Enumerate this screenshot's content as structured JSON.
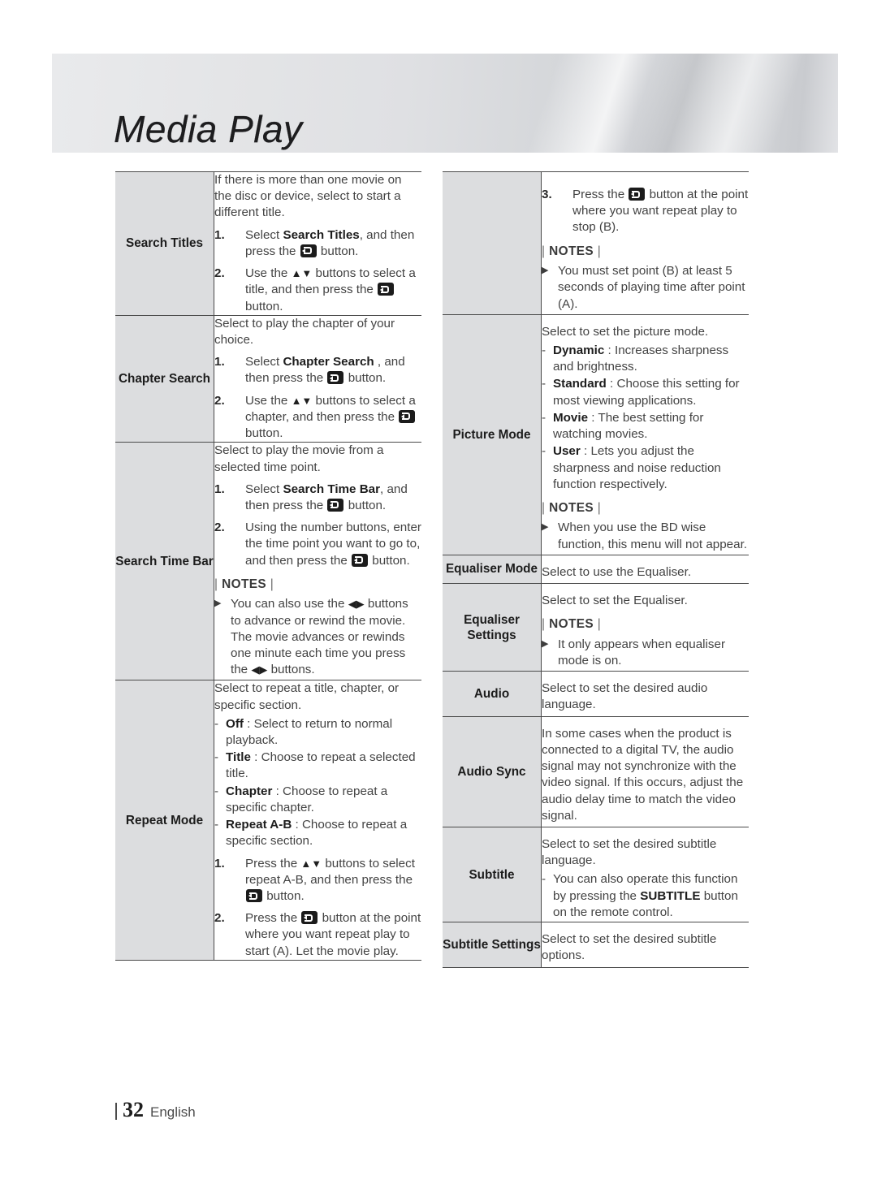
{
  "page": {
    "banner_title": "Media Play",
    "footer_page_number": "32",
    "footer_language": "English",
    "notes_label": "NOTES",
    "icon_enter_name": "enter-button-icon"
  },
  "left_column": [
    {
      "label": "Search Titles",
      "intro": "If there is more than one movie on the disc or device, select to start a different title.",
      "steps": [
        {
          "num": "1.",
          "pre": "Select ",
          "kw": "Search Titles",
          "post": ", and then press the ",
          "tail": " button."
        },
        {
          "num": "2.",
          "pre": "Use the ",
          "arrows": "▲▼",
          "post": " buttons to select a title, and then press the ",
          "tail": " button."
        }
      ]
    },
    {
      "label": "Chapter Search",
      "intro": "Select to play the chapter of your choice.",
      "steps": [
        {
          "num": "1.",
          "pre": "Select ",
          "kw": "Chapter Search",
          "post": " , and then press the ",
          "tail": " button."
        },
        {
          "num": "2.",
          "pre": "Use the ",
          "arrows": "▲▼",
          "post": " buttons to select a chapter, and then press the ",
          "tail": " button."
        }
      ]
    },
    {
      "label": "Search Time Bar",
      "intro": "Select to play the movie from a selected time point.",
      "steps": [
        {
          "num": "1.",
          "pre": "Select ",
          "kw": "Search Time Bar",
          "post": ", and then press the ",
          "tail": " button."
        },
        {
          "num": "2.",
          "pre": "Using the number buttons, enter the time point you want to go to, and then press the ",
          "tail": " button."
        }
      ],
      "notes": [
        {
          "pre": "You can also use the ",
          "arrows": "◀▶",
          "mid": " buttons to advance or rewind the movie. The movie advances or rewinds one minute each time you press the ",
          "arrows2": "◀▶",
          "post": " buttons."
        }
      ]
    },
    {
      "label": "Repeat Mode",
      "intro": "Select to repeat a title, chapter, or specific section.",
      "dashes": [
        {
          "kw": "Off",
          "text": " : Select to return to normal playback."
        },
        {
          "kw": "Title",
          "text": " : Choose to repeat a selected title."
        },
        {
          "kw": "Chapter",
          "text": " : Choose to repeat a specific chapter."
        },
        {
          "kw": "Repeat A-B",
          "text": " : Choose to repeat a specific section."
        }
      ],
      "steps": [
        {
          "num": "1.",
          "pre": "Press the ",
          "arrows": "▲▼",
          "post": " buttons to select repeat A-B, and then press the ",
          "tail": " button."
        },
        {
          "num": "2.",
          "pre": "Press the ",
          "tail_first": true,
          "post": " button at the point where you want repeat play to start (A). Let the movie play."
        }
      ]
    }
  ],
  "right_column": [
    {
      "label": "",
      "steps": [
        {
          "num": "3.",
          "pre": "Press the ",
          "tail_first": true,
          "post": " button at the point where you want repeat play to stop (B)."
        }
      ],
      "notes": [
        {
          "pre": "You must set point (B) at least 5 seconds of playing time after point (A)."
        }
      ]
    },
    {
      "label": "Picture Mode",
      "intro": "Select to set the picture mode.",
      "dashes": [
        {
          "kw": "Dynamic",
          "text": " : Increases sharpness and brightness."
        },
        {
          "kw": "Standard",
          "text": " : Choose this setting for most viewing applications."
        },
        {
          "kw": "Movie",
          "text": " : The best setting for watching movies."
        },
        {
          "kw": "User",
          "text": " : Lets you adjust the sharpness and noise reduction function respectively."
        }
      ],
      "notes": [
        {
          "pre": "When you use the BD wise function, this menu will not appear."
        }
      ]
    },
    {
      "label": "Equaliser Mode",
      "intro": "Select to use the Equaliser."
    },
    {
      "label": "Equaliser Settings",
      "intro": "Select to set the Equaliser.",
      "notes": [
        {
          "pre": "It only appears when equaliser mode is on."
        }
      ]
    },
    {
      "label": "Audio",
      "intro": "Select to set the desired audio language."
    },
    {
      "label": "Audio Sync",
      "intro": "In some cases when the product is connected to a digital TV, the audio signal may not synchronize with the video signal. If this occurs, adjust the audio delay time to match the video signal."
    },
    {
      "label": "Subtitle",
      "intro": "Select to set the desired subtitle language.",
      "dashes": [
        {
          "kw": "",
          "text": "You can also operate this function by pressing the ",
          "kw2": "SUBTITLE",
          "text2": " button on the remote control."
        }
      ]
    },
    {
      "label": "Subtitle Settings",
      "intro": "Select to set the desired subtitle options."
    }
  ]
}
